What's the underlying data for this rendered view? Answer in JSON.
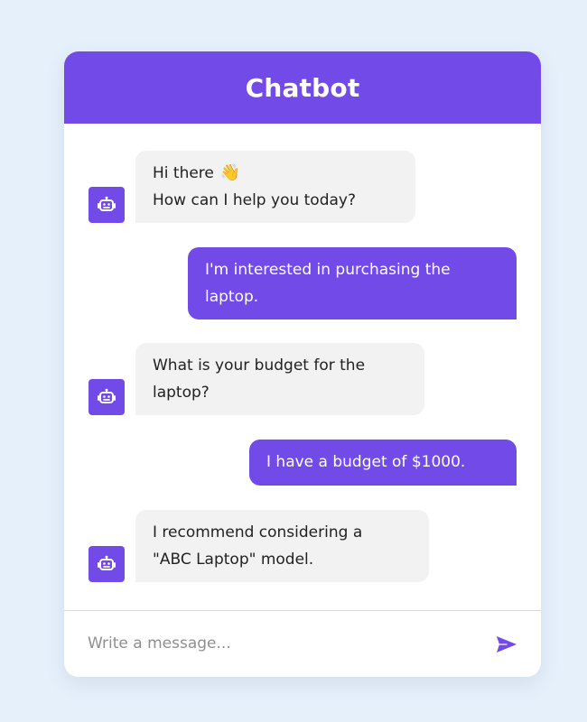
{
  "header": {
    "title": "Chatbot"
  },
  "colors": {
    "accent": "#724ae8",
    "background": "#e6f0fb",
    "bot_bubble": "#f2f2f2",
    "text": "#222222"
  },
  "messages": [
    {
      "sender": "bot",
      "icon": "robot-icon",
      "lines": [
        "Hi there",
        "How can I help you today?"
      ],
      "emoji": "👋"
    },
    {
      "sender": "user",
      "lines": [
        "I'm interested in purchasing the",
        "laptop."
      ]
    },
    {
      "sender": "bot",
      "icon": "robot-icon",
      "lines": [
        "What is your budget for the",
        "laptop?"
      ]
    },
    {
      "sender": "user",
      "lines": [
        "I have a budget of $1000."
      ]
    },
    {
      "sender": "bot",
      "icon": "robot-icon",
      "lines": [
        "I recommend considering a",
        "\"ABC Laptop\" model."
      ]
    }
  ],
  "composer": {
    "placeholder": "Write a message...",
    "value": "",
    "send_icon": "send-icon"
  }
}
